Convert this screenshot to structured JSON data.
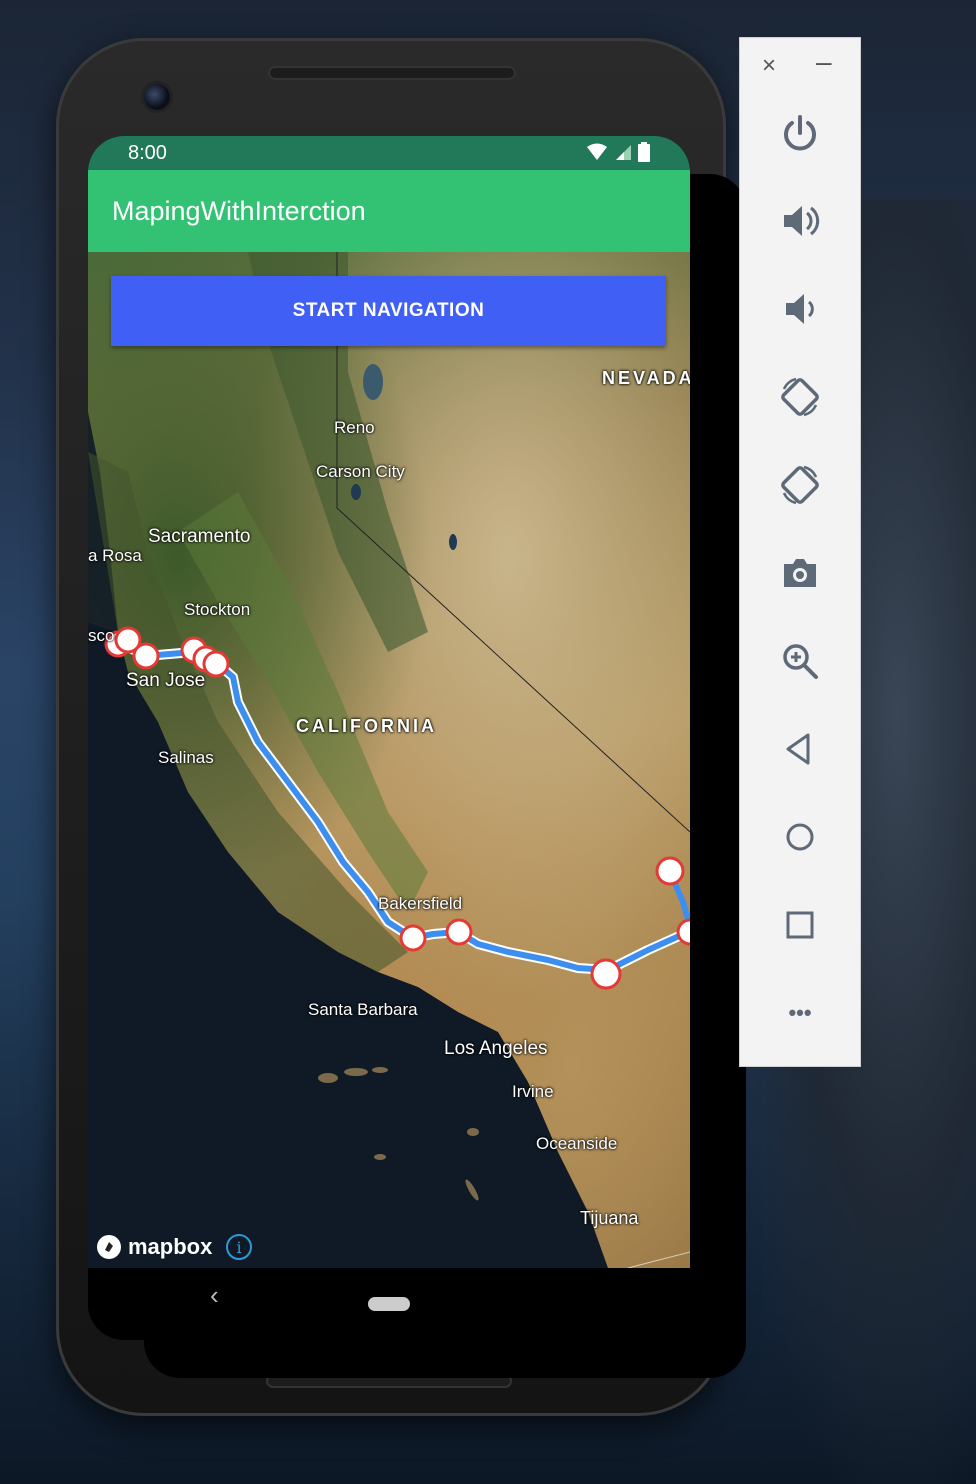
{
  "status_bar": {
    "time": "8:00"
  },
  "app_bar": {
    "title": "MapingWithInterction"
  },
  "map": {
    "start_button_label": "START NAVIGATION",
    "labels": {
      "nevada": "NEVADA",
      "reno": "Reno",
      "carson_city": "Carson City",
      "sacramento": "Sacramento",
      "santa_rosa": "a Rosa",
      "stockton": "Stockton",
      "san_francisco": "sco",
      "san_jose": "San Jose",
      "california": "CALIFORNIA",
      "salinas": "Salinas",
      "bakersfield": "Bakersfield",
      "santa_barbara": "Santa Barbara",
      "los_angeles": "Los Angeles",
      "irvine": "Irvine",
      "oceanside": "Oceanside",
      "tijuana": "Tijuana"
    },
    "attribution": {
      "logo_text": "mapbox",
      "info_symbol": "i"
    },
    "route_color": "#3d8fef",
    "marker_color": "#e53935"
  },
  "emulator_panel": {
    "close_symbol": "×",
    "minimize_symbol": "–",
    "buttons": [
      "power-icon",
      "volume-up-icon",
      "volume-down-icon",
      "rotate-left-icon",
      "rotate-right-icon",
      "camera-icon",
      "zoom-icon",
      "back-icon",
      "home-icon",
      "overview-icon",
      "more-icon"
    ],
    "more_symbol": "•••"
  },
  "nav_bar": {
    "back_symbol": "‹"
  }
}
